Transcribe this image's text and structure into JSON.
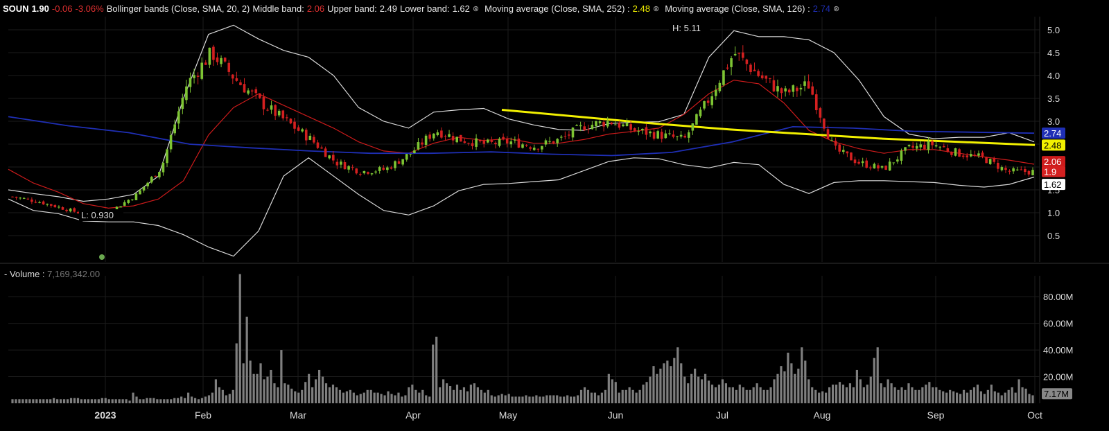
{
  "legend": {
    "symbol": "SOUN",
    "price": "1.90",
    "change": "-0.06",
    "change_pct": "-3.06%",
    "bb_label": "Bollinger bands (Close, SMA, 20, 2)",
    "bb_middle_label": "Middle band:",
    "bb_middle": "2.06",
    "bb_upper_label": "Upper band:",
    "bb_upper": "2.49",
    "bb_lower_label": "Lower band:",
    "bb_lower": "1.62",
    "ma252_label": "Moving average (Close, SMA, 252) :",
    "ma252": "2.48",
    "ma126_label": "Moving average (Close, SMA, 126) :",
    "ma126": "2.74",
    "close_icon": "circle-x-icon"
  },
  "volume_legend": {
    "label": "- Volume :",
    "value": "7,169,342.00"
  },
  "colors": {
    "background": "#000000",
    "up": "#7dc433",
    "down": "#d42020",
    "bb_band": "#d9d9d9",
    "bb_middle": "#cc1b1b",
    "ma252": "#f2f000",
    "ma126": "#1f2fb5",
    "volume": "#7f7f7f",
    "grid": "#1c1c1c"
  },
  "chart_data": [
    {
      "type": "candlestick",
      "title": "",
      "ylim": [
        0,
        5.3
      ],
      "y_ticks": [
        "0.5",
        "1.0",
        "1.5",
        "2.0",
        "2.5",
        "3.0",
        "3.5",
        "4.0",
        "4.5",
        "5.0"
      ],
      "x_ticks": [
        "2023",
        "Feb",
        "Mar",
        "Apr",
        "May",
        "Jun",
        "Jul",
        "Aug",
        "Sep",
        "Oct"
      ],
      "annotations": {
        "high": "H: 5.11",
        "low": "L: 0.930"
      },
      "last_labels": {
        "ma126": "2.74",
        "ma252": "2.48",
        "bb_middle": "2.06",
        "close": "1.9",
        "bb_lower": "1.62"
      },
      "series": [
        {
          "name": "Bollinger bands (Close, SMA, 20, 2)",
          "upper": [
            1.3,
            1.05,
            0.98,
            0.82,
            0.8,
            0.8,
            0.72,
            0.52,
            0.25,
            0.05,
            0.6,
            1.8,
            2.2,
            1.8,
            1.4,
            1.05,
            0.95,
            1.15,
            1.48,
            1.62,
            1.64,
            1.68,
            1.72,
            1.92,
            2.12,
            2.2,
            2.18,
            2.05,
            1.98,
            2.1,
            2.05,
            1.62,
            1.42,
            1.66,
            1.7,
            1.7,
            1.68,
            1.66,
            1.6,
            1.56,
            1.62,
            1.78
          ],
          "top": [
            1.5,
            1.42,
            1.35,
            1.25,
            1.3,
            1.4,
            1.8,
            3.5,
            4.9,
            5.1,
            4.8,
            4.55,
            4.4,
            4.0,
            3.3,
            3.0,
            2.85,
            3.2,
            3.25,
            3.28,
            3.05,
            2.92,
            2.82,
            2.8,
            2.95,
            2.98,
            2.99,
            3.15,
            4.4,
            4.98,
            4.85,
            4.85,
            4.78,
            4.5,
            3.9,
            3.1,
            2.72,
            2.62,
            2.65,
            2.65,
            2.75,
            2.55
          ]
        },
        {
          "name": "Middle band",
          "values": [
            1.95,
            1.65,
            1.45,
            1.2,
            1.1,
            1.15,
            1.3,
            1.7,
            2.7,
            3.3,
            3.6,
            3.35,
            3.1,
            2.85,
            2.55,
            2.35,
            2.3,
            2.52,
            2.65,
            2.58,
            2.62,
            2.52,
            2.52,
            2.6,
            2.72,
            2.78,
            2.85,
            3.15,
            3.6,
            3.9,
            3.82,
            3.4,
            2.8,
            2.55,
            2.4,
            2.3,
            2.38,
            2.38,
            2.3,
            2.22,
            2.15,
            2.06
          ]
        },
        {
          "name": "Moving average (Close, SMA, 252)",
          "values": [
            3.25,
            3.1,
            2.95,
            2.82,
            2.72,
            2.62,
            2.55,
            2.48
          ]
        },
        {
          "name": "Moving average (Close, SMA, 126)",
          "values": [
            3.1,
            2.9,
            2.75,
            2.5,
            2.42,
            2.35,
            2.3,
            2.3,
            2.33,
            2.28,
            2.25,
            2.32,
            2.55,
            2.88,
            2.85,
            2.78,
            2.76,
            2.74
          ]
        }
      ]
    },
    {
      "type": "bar",
      "title": "Volume",
      "ylim": [
        0,
        100000000
      ],
      "y_ticks": [
        "20.00M",
        "40.00M",
        "60.00M",
        "80.00M"
      ],
      "last_label": "7.17M",
      "values": [
        3,
        3,
        3,
        3,
        3,
        3,
        3,
        3,
        3,
        3,
        3,
        3,
        4,
        3,
        3,
        3,
        3,
        4,
        4,
        4,
        3,
        3,
        3,
        3,
        3,
        3,
        4,
        4,
        3,
        3,
        3,
        3,
        3,
        3,
        2,
        8,
        5,
        3,
        3,
        4,
        4,
        4,
        3,
        3,
        3,
        3,
        3,
        4,
        4,
        5,
        4,
        8,
        5,
        4,
        3,
        4,
        5,
        6,
        8,
        18,
        12,
        10,
        6,
        7,
        10,
        45,
        97,
        30,
        65,
        32,
        22,
        22,
        30,
        18,
        20,
        25,
        15,
        12,
        40,
        15,
        14,
        11,
        9,
        8,
        10,
        16,
        22,
        12,
        18,
        25,
        20,
        15,
        12,
        14,
        12,
        10,
        8,
        9,
        10,
        8,
        6,
        7,
        8,
        10,
        10,
        8,
        8,
        7,
        6,
        9,
        7,
        6,
        8,
        5,
        6,
        12,
        14,
        10,
        8,
        10,
        6,
        5,
        44,
        50,
        12,
        18,
        15,
        13,
        10,
        14,
        10,
        12,
        9,
        14,
        15,
        12,
        10,
        8,
        10,
        6,
        5,
        6,
        7,
        6,
        7,
        5,
        5,
        5,
        5,
        6,
        5,
        5,
        6,
        5,
        5,
        6,
        6,
        6,
        6,
        5,
        5,
        6,
        5,
        5,
        6,
        10,
        12,
        10,
        8,
        8,
        6,
        8,
        10,
        22,
        18,
        16,
        8,
        10,
        10,
        12,
        10,
        8,
        10,
        14,
        16,
        20,
        28,
        22,
        26,
        30,
        32,
        28,
        34,
        42,
        30,
        20,
        15,
        22,
        26,
        20,
        18,
        22,
        17,
        14,
        12,
        14,
        18,
        15,
        12,
        12,
        10,
        14,
        12,
        10,
        10,
        12,
        15,
        12,
        10,
        10,
        12,
        18,
        22,
        28,
        24,
        38,
        30,
        22,
        26,
        42,
        32,
        18,
        12,
        10,
        8,
        9,
        8,
        12,
        14,
        14,
        16,
        14,
        12,
        15,
        12,
        25,
        18,
        12,
        14,
        20,
        34,
        42,
        15,
        12,
        18,
        15,
        12,
        10,
        12,
        10,
        15,
        12,
        10,
        10,
        12,
        14,
        16,
        12,
        12,
        10,
        9,
        8,
        10,
        9,
        8,
        7,
        10,
        8,
        10,
        12,
        14,
        9,
        7,
        10,
        14,
        9,
        8,
        6,
        8,
        10,
        12,
        8,
        18,
        12,
        11,
        7,
        6
      ]
    }
  ]
}
